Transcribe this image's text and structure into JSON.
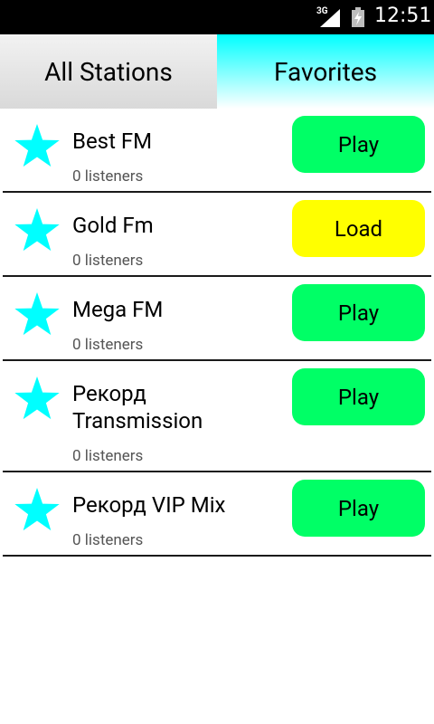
{
  "status_bar": {
    "network": "3G",
    "time": "12:51"
  },
  "tabs": [
    {
      "label": "All Stations"
    },
    {
      "label": "Favorites"
    }
  ],
  "stations": [
    {
      "name": "Best FM",
      "listeners": "0 listeners",
      "action": "Play"
    },
    {
      "name": "Gold Fm",
      "listeners": "0 listeners",
      "action": "Load"
    },
    {
      "name": "Mega FM",
      "listeners": "0 listeners",
      "action": "Play"
    },
    {
      "name": "Рекорд Transmission",
      "listeners": "0 listeners",
      "action": "Play"
    },
    {
      "name": "Рекорд VIP Mix",
      "listeners": "0 listeners",
      "action": "Play"
    }
  ],
  "colors": {
    "play_button": "#00ff66",
    "load_button": "#ffff00",
    "star": "#00ffff",
    "favorites_tab": "#00ffff"
  }
}
